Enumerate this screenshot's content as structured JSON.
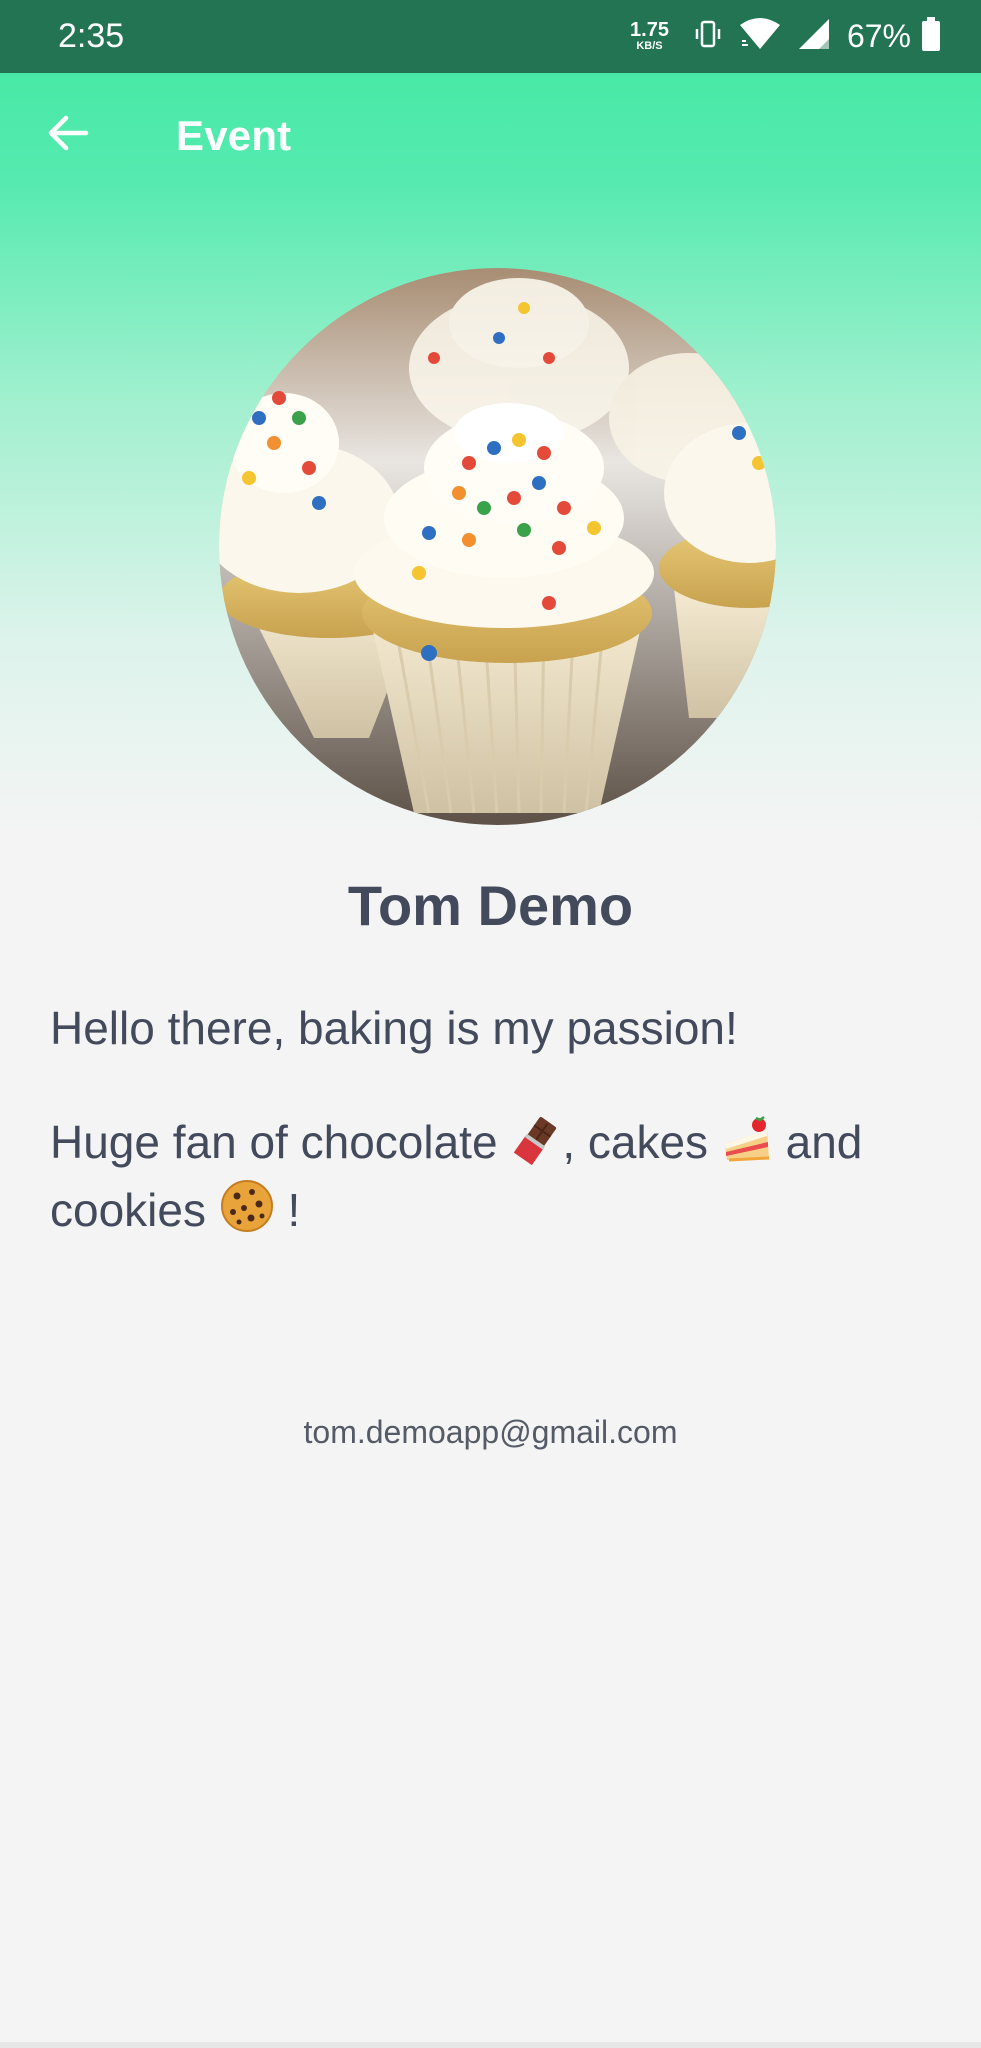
{
  "status_bar": {
    "time": "2:35",
    "net_speed_value": "1.75",
    "net_speed_unit": "KB/S",
    "battery_percent": "67%",
    "icons": [
      "vibrate-icon",
      "wifi-icon",
      "cellular-signal-icon",
      "battery-icon"
    ]
  },
  "app_bar": {
    "back_icon": "arrow-left-icon",
    "title": "Event"
  },
  "profile": {
    "avatar_description": "cupcakes-photo",
    "name": "Tom Demo",
    "bio_line1": "Hello there, baking is my passion!",
    "bio_line2_a": "Huge fan of chocolate",
    "bio_line2_b": ", cakes",
    "bio_line2_c": " and cookies",
    "bio_line2_d": " !",
    "email": "tom.demoapp@gmail.com"
  },
  "colors": {
    "status_bar": "#227452",
    "header_green": "#48e9a7",
    "background": "#f4f4f4",
    "text_primary": "#424a5c",
    "text_secondary": "#555b66"
  }
}
